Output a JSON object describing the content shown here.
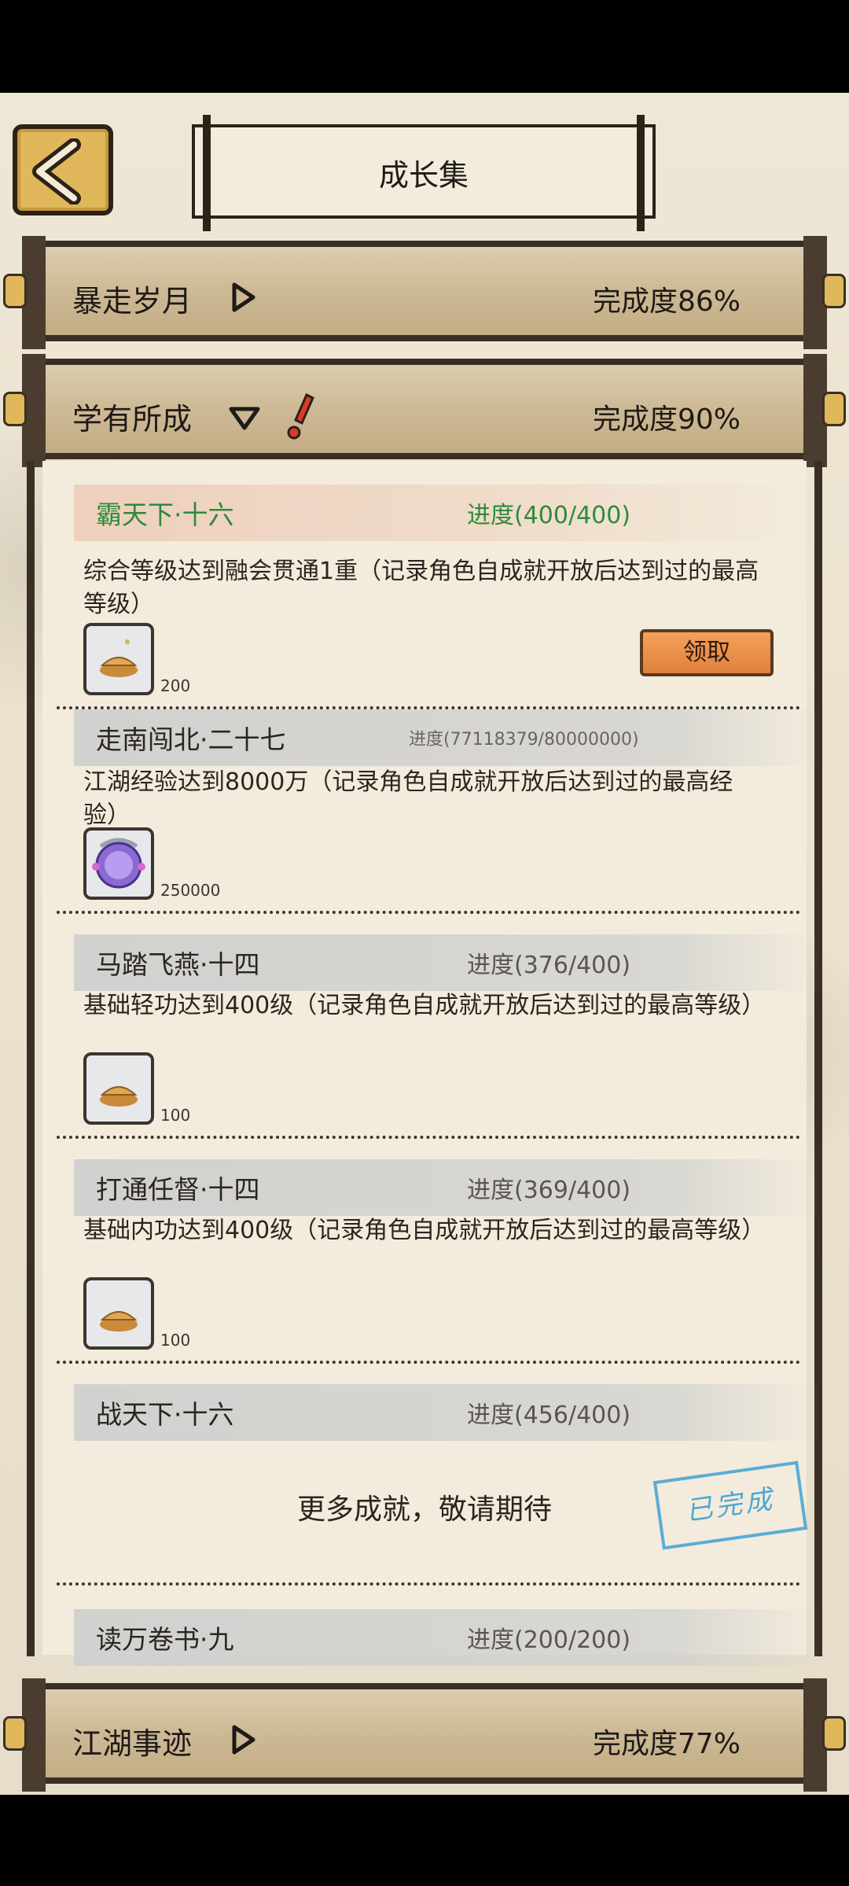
{
  "header": {
    "title": "成长集"
  },
  "sections": [
    {
      "name": "暴走岁月",
      "progress": "完成度86%",
      "expanded": false
    },
    {
      "name": "学有所成",
      "progress": "完成度90%",
      "expanded": true,
      "alert": true
    },
    {
      "name": "江湖事迹",
      "progress": "完成度77%",
      "expanded": false
    }
  ],
  "achievements": [
    {
      "name": "霸天下·十六",
      "progress": "进度(400/400)",
      "desc": "综合等级达到融会贯通1重（记录角色自成就开放后达到过的最高等级）",
      "reward_icon": "gold-ingot-icon",
      "reward_count": "200",
      "button": "领取",
      "status": "claimable"
    },
    {
      "name": "走南闯北·二十七",
      "progress": "进度(77118379/80000000)",
      "desc": "江湖经验达到8000万（记录角色自成就开放后达到过的最高经验）",
      "reward_icon": "potential-orb-icon",
      "reward_count": "250000"
    },
    {
      "name": "马踏飞燕·十四",
      "progress": "进度(376/400)",
      "desc": "基础轻功达到400级（记录角色自成就开放后达到过的最高等级）",
      "reward_icon": "gold-ingot-icon",
      "reward_count": "100"
    },
    {
      "name": "打通任督·十四",
      "progress": "进度(369/400)",
      "desc": "基础内功达到400级（记录角色自成就开放后达到过的最高等级）",
      "reward_icon": "gold-ingot-icon",
      "reward_count": "100"
    },
    {
      "name": "战天下·十六",
      "progress": "进度(456/400)"
    },
    {
      "name": "读万卷书·九",
      "progress": "进度(200/200)"
    }
  ],
  "more_text": "更多成就，敬请期待",
  "stamp_text": "已完成",
  "colors": {
    "accent": "#e0813e",
    "complete_green": "#2f8a3c",
    "stamp_blue": "#3f9fd1"
  }
}
